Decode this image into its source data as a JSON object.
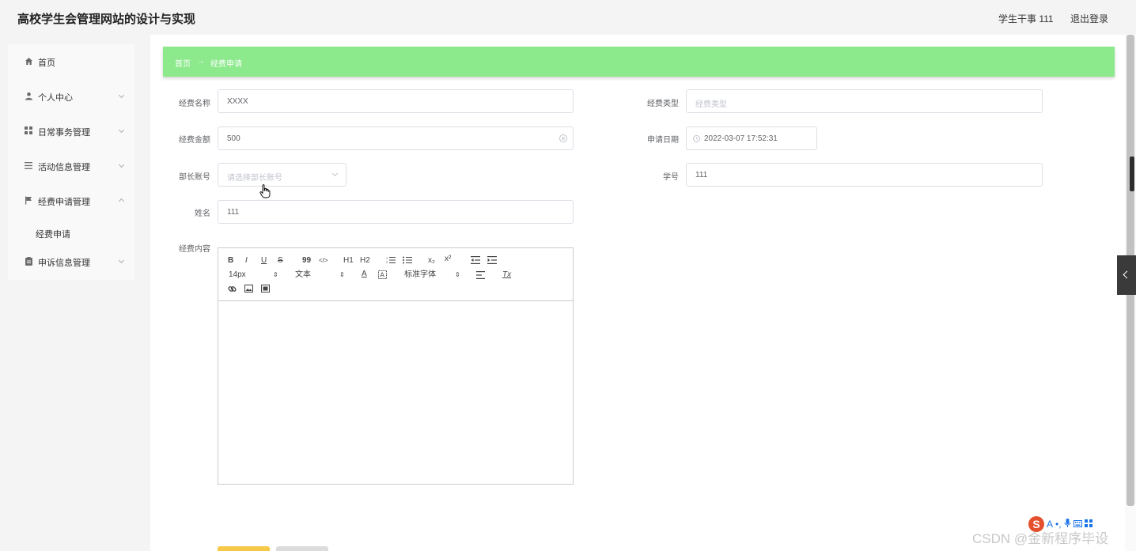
{
  "app": {
    "title": "高校学生会管理网站的设计与实现",
    "user": "学生干事 111",
    "logout": "退出登录"
  },
  "sidebar": {
    "items": [
      {
        "label": "首页",
        "icon": "home-icon"
      },
      {
        "label": "个人中心",
        "icon": "user-icon"
      },
      {
        "label": "日常事务管理",
        "icon": "grid-icon"
      },
      {
        "label": "活动信息管理",
        "icon": "list-icon"
      },
      {
        "label": "经费申请管理",
        "icon": "flag-icon"
      },
      {
        "label": "申诉信息管理",
        "icon": "clipboard-icon"
      }
    ],
    "sub_item": "经费申请"
  },
  "breadcrumb": {
    "home": "首页",
    "arrow": "→",
    "current": "经费申请"
  },
  "form": {
    "name_label": "经费名称",
    "name_value": "XXXX",
    "type_label": "经费类型",
    "type_placeholder": "经费类型",
    "amount_label": "经费金额",
    "amount_value": "500",
    "date_label": "申请日期",
    "date_value": "2022-03-07 17:52:31",
    "minister_label": "部长账号",
    "minister_placeholder": "请选择部长账号",
    "student_id_label": "学号",
    "student_id_value": "111",
    "student_name_label": "姓名",
    "student_name_value": "111",
    "content_label": "经费内容"
  },
  "editor": {
    "bold": "B",
    "italic": "I",
    "underline": "U",
    "strike": "S",
    "quote": "99",
    "code": "</>",
    "h1": "H1",
    "h2": "H2",
    "sub": "x₂",
    "sup": "x²",
    "size": "14px",
    "header": "文本",
    "font": "标准字体"
  },
  "watermark": "CSDN @金新程序毕设",
  "ime": {
    "logo": "S",
    "char": "A"
  },
  "colors": {
    "breadcrumb_bg": "#8ce98c",
    "submit_button": "#f7c948",
    "sidebar_bg": "#f9f9f9"
  }
}
